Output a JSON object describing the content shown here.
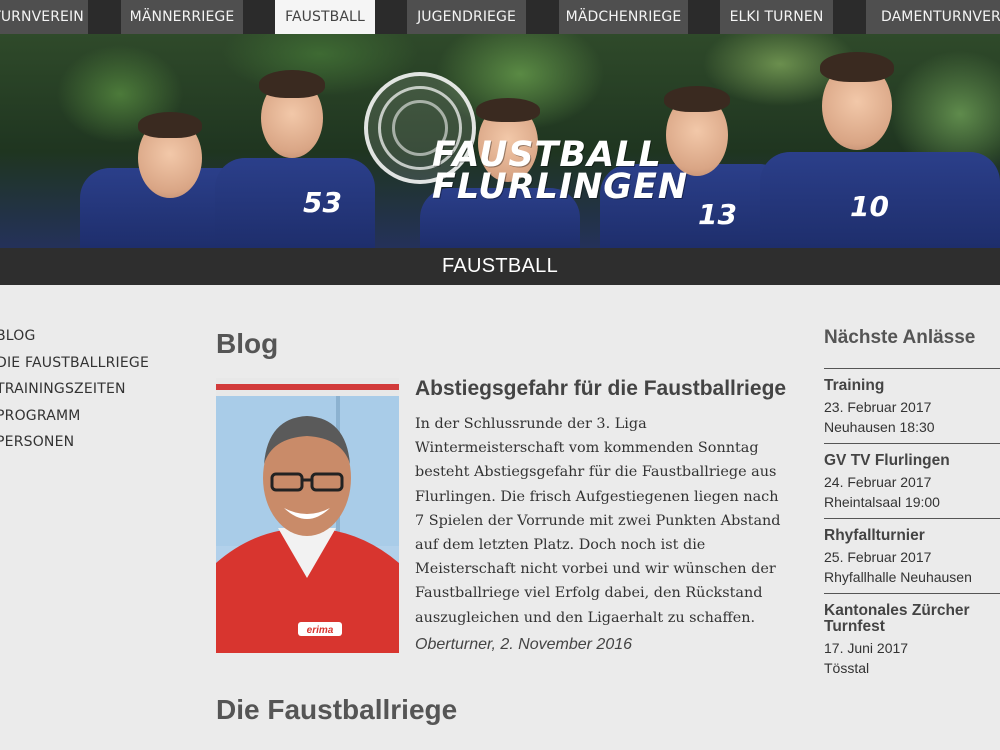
{
  "topnav": {
    "items": [
      {
        "label": "TURNVEREIN",
        "active": false
      },
      {
        "label": "MÄNNERRIEGE",
        "active": false
      },
      {
        "label": "FAUSTBALL",
        "active": true
      },
      {
        "label": "JUGENDRIEGE",
        "active": false
      },
      {
        "label": "MÄDCHENRIEGE",
        "active": false
      },
      {
        "label": "ELKI TURNEN",
        "active": false
      },
      {
        "label": "DAMENTURNVEREIN",
        "active": false
      }
    ]
  },
  "hero": {
    "logo_line1": "FAUSTBALL",
    "logo_line2": "FLURLINGEN",
    "jersey_numbers": [
      "53",
      "13",
      "10"
    ]
  },
  "section": {
    "title": "FAUSTBALL"
  },
  "sidenav": {
    "items": [
      "BLOG",
      "DIE FAUSTBALLRIEGE",
      "TRAININGSZEITEN",
      "PROGRAMM",
      "PERSONEN"
    ]
  },
  "main": {
    "heading": "Blog",
    "post": {
      "title": "Abstiegsgefahr für die Faustballriege",
      "body": "In der Schlussrunde der 3. Liga Wintermeisterschaft vom kommenden Sonntag besteht Abstiegsgefahr für die Faustballriege aus Flurlingen. Die frisch Aufgestiegenen liegen nach 7 Spielen der Vorrunde mit zwei Punkten Abstand auf dem letzten Platz. Doch noch ist die Meisterschaft nicht vorbei und wir wünschen der Faustballriege viel Erfolg dabei, den Rückstand auszugleichen und den Ligaerhalt zu schaffen.",
      "meta": "Oberturner, 2. November 2016",
      "image_shirt_text": "erima"
    },
    "next_heading": "Die Faustballriege"
  },
  "events": {
    "title": "Nächste Anlässe",
    "items": [
      {
        "name": "Training",
        "date": "23. Februar 2017",
        "place": "Neuhausen  18:30"
      },
      {
        "name": "GV TV Flurlingen",
        "date": "24. Februar 2017",
        "place": "Rheintalsaal  19:00"
      },
      {
        "name": "Rhyfallturnier",
        "date": "25. Februar 2017",
        "place": "Rhyfallhalle Neuhausen"
      },
      {
        "name": "Kantonales Zürcher Turnfest",
        "date": "17. Juni 2017",
        "place": "Tösstal"
      }
    ]
  }
}
